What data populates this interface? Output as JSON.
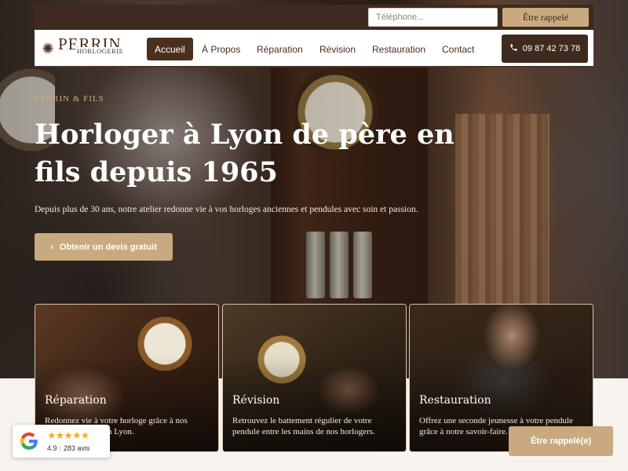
{
  "topbar": {
    "phone_placeholder": "Téléphone...",
    "callback_label": "Être rappelé"
  },
  "brand": {
    "name": "PERRIN",
    "sub": "HORLOGERIE"
  },
  "nav": {
    "items": [
      {
        "label": "Accueil",
        "active": true
      },
      {
        "label": "À Propos"
      },
      {
        "label": "Réparation"
      },
      {
        "label": "Révision"
      },
      {
        "label": "Restauration"
      },
      {
        "label": "Contact"
      }
    ],
    "phone": "09 87 42 73 78"
  },
  "hero": {
    "eyebrow": "PERRIN & FILS",
    "title": "Horloger à Lyon de père en fils depuis 1965",
    "description": "Depuis plus de 30 ans, notre atelier redonne vie à vos horloges anciennes et pendules avec soin et passion.",
    "cta": "Obtenir un devis gratuit"
  },
  "services": [
    {
      "title": "Réparation",
      "description": "Redonnez vie à votre horloge grâce à nos artisans horlogers à Lyon."
    },
    {
      "title": "Révision",
      "description": "Retrouvez le battement régulier de votre pendule entre les mains de nos horlogers."
    },
    {
      "title": "Restauration",
      "description": "Offrez une seconde jeunesse à votre pendule grâce à notre savoir-faire."
    }
  ],
  "google_reviews": {
    "rating": "4.9",
    "stars": "★★★★★",
    "count": "283 avis"
  },
  "floating_cta": "Être rappelé(e)",
  "colors": {
    "accent": "#c9aa80",
    "brown": "#3f2a1f",
    "star": "#f2b01e"
  }
}
